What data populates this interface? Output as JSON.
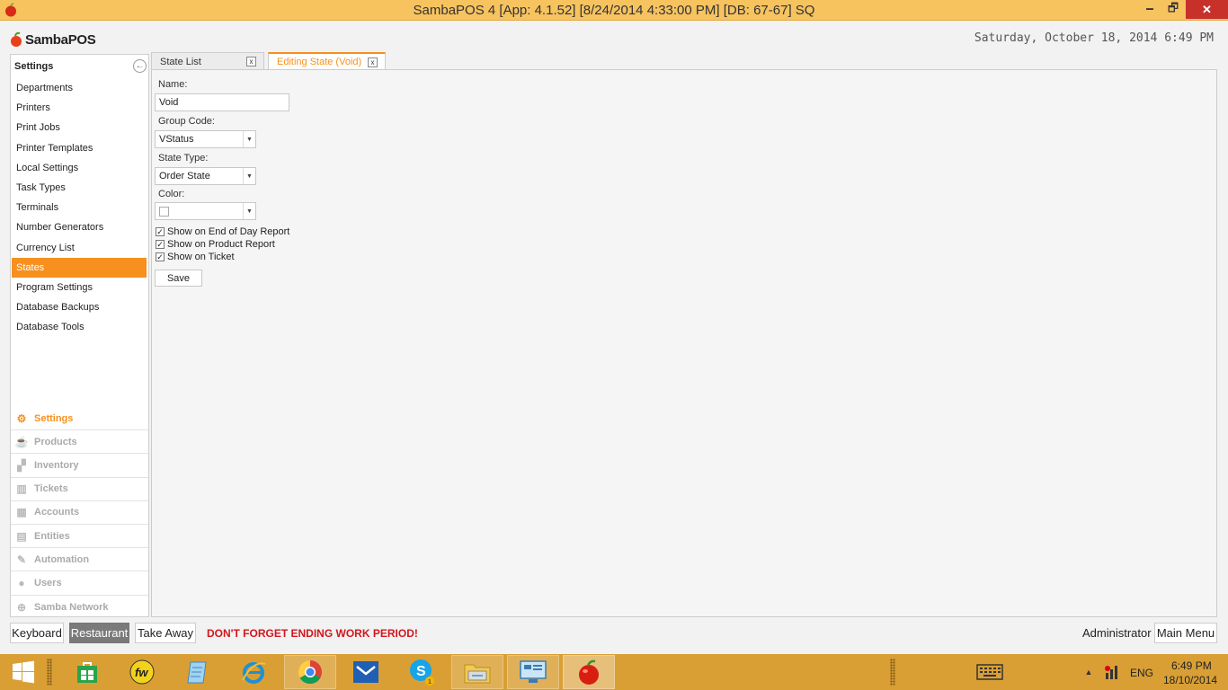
{
  "window": {
    "title": "SambaPOS 4 [App: 4.1.52] [8/24/2014 4:33:00 PM] [DB: 67-67] SQ",
    "minimize_glyph": "🗕",
    "maximize_glyph": "🗗",
    "close_glyph": "✕"
  },
  "header": {
    "logo_text": "SambaPOS",
    "datetime": "Saturday, October 18, 2014 6:49 PM"
  },
  "sidebar": {
    "title": "Settings",
    "back_glyph": "←",
    "items": [
      {
        "label": "Departments"
      },
      {
        "label": "Printers"
      },
      {
        "label": "Print Jobs"
      },
      {
        "label": "Printer Templates"
      },
      {
        "label": "Local Settings"
      },
      {
        "label": "Task Types"
      },
      {
        "label": "Terminals"
      },
      {
        "label": "Number Generators"
      },
      {
        "label": "Currency List"
      },
      {
        "label": "States"
      },
      {
        "label": "Program Settings"
      },
      {
        "label": "Database Backups"
      },
      {
        "label": "Database Tools"
      }
    ],
    "active_item": "States",
    "sections": [
      {
        "label": "Settings",
        "icon": "gear-icon"
      },
      {
        "label": "Products",
        "icon": "cup-icon"
      },
      {
        "label": "Inventory",
        "icon": "boxes-icon"
      },
      {
        "label": "Tickets",
        "icon": "tickets-icon"
      },
      {
        "label": "Accounts",
        "icon": "calculator-icon"
      },
      {
        "label": "Entities",
        "icon": "table-icon"
      },
      {
        "label": "Automation",
        "icon": "pen-icon"
      },
      {
        "label": "Users",
        "icon": "user-icon"
      },
      {
        "label": "Samba Network",
        "icon": "globe-icon"
      }
    ],
    "active_section": "Settings"
  },
  "tabs": [
    {
      "label": "State List",
      "close": "x"
    },
    {
      "label": "Editing State (Void)",
      "close": "x"
    }
  ],
  "form": {
    "name_label": "Name:",
    "name_value": "Void",
    "group_code_label": "Group Code:",
    "group_code_value": "VStatus",
    "state_type_label": "State Type:",
    "state_type_value": "Order State",
    "color_label": "Color:",
    "color_value": "",
    "checkboxes": [
      {
        "label": "Show on End of Day Report",
        "checked": true
      },
      {
        "label": "Show on Product Report",
        "checked": true
      },
      {
        "label": "Show on Ticket",
        "checked": true
      }
    ],
    "check_glyph": "✓",
    "dropdown_glyph": "▼",
    "save_label": "Save"
  },
  "bottom_bar": {
    "keyboard_label": "Keyboard",
    "restaurant_label": "Restaurant",
    "takeaway_label": "Take Away",
    "warning": "DON'T FORGET ENDING WORK PERIOD!",
    "user": "Administrator",
    "main_menu_label": "Main Menu"
  },
  "taskbar": {
    "apps": [
      "windows-start-icon",
      "store-icon",
      "fw-icon",
      "notepad-icon",
      "ie-icon",
      "chrome-icon",
      "mail-icon",
      "skype-icon",
      "explorer-icon",
      "remote-desktop-icon",
      "sambapos-icon"
    ],
    "language": "ENG",
    "time": "6:49 PM",
    "date": "18/10/2014"
  },
  "colors": {
    "accent": "#f7901e",
    "titlebar": "#f7c35f",
    "taskbar": "#d99f35",
    "warning": "#d0171d"
  }
}
